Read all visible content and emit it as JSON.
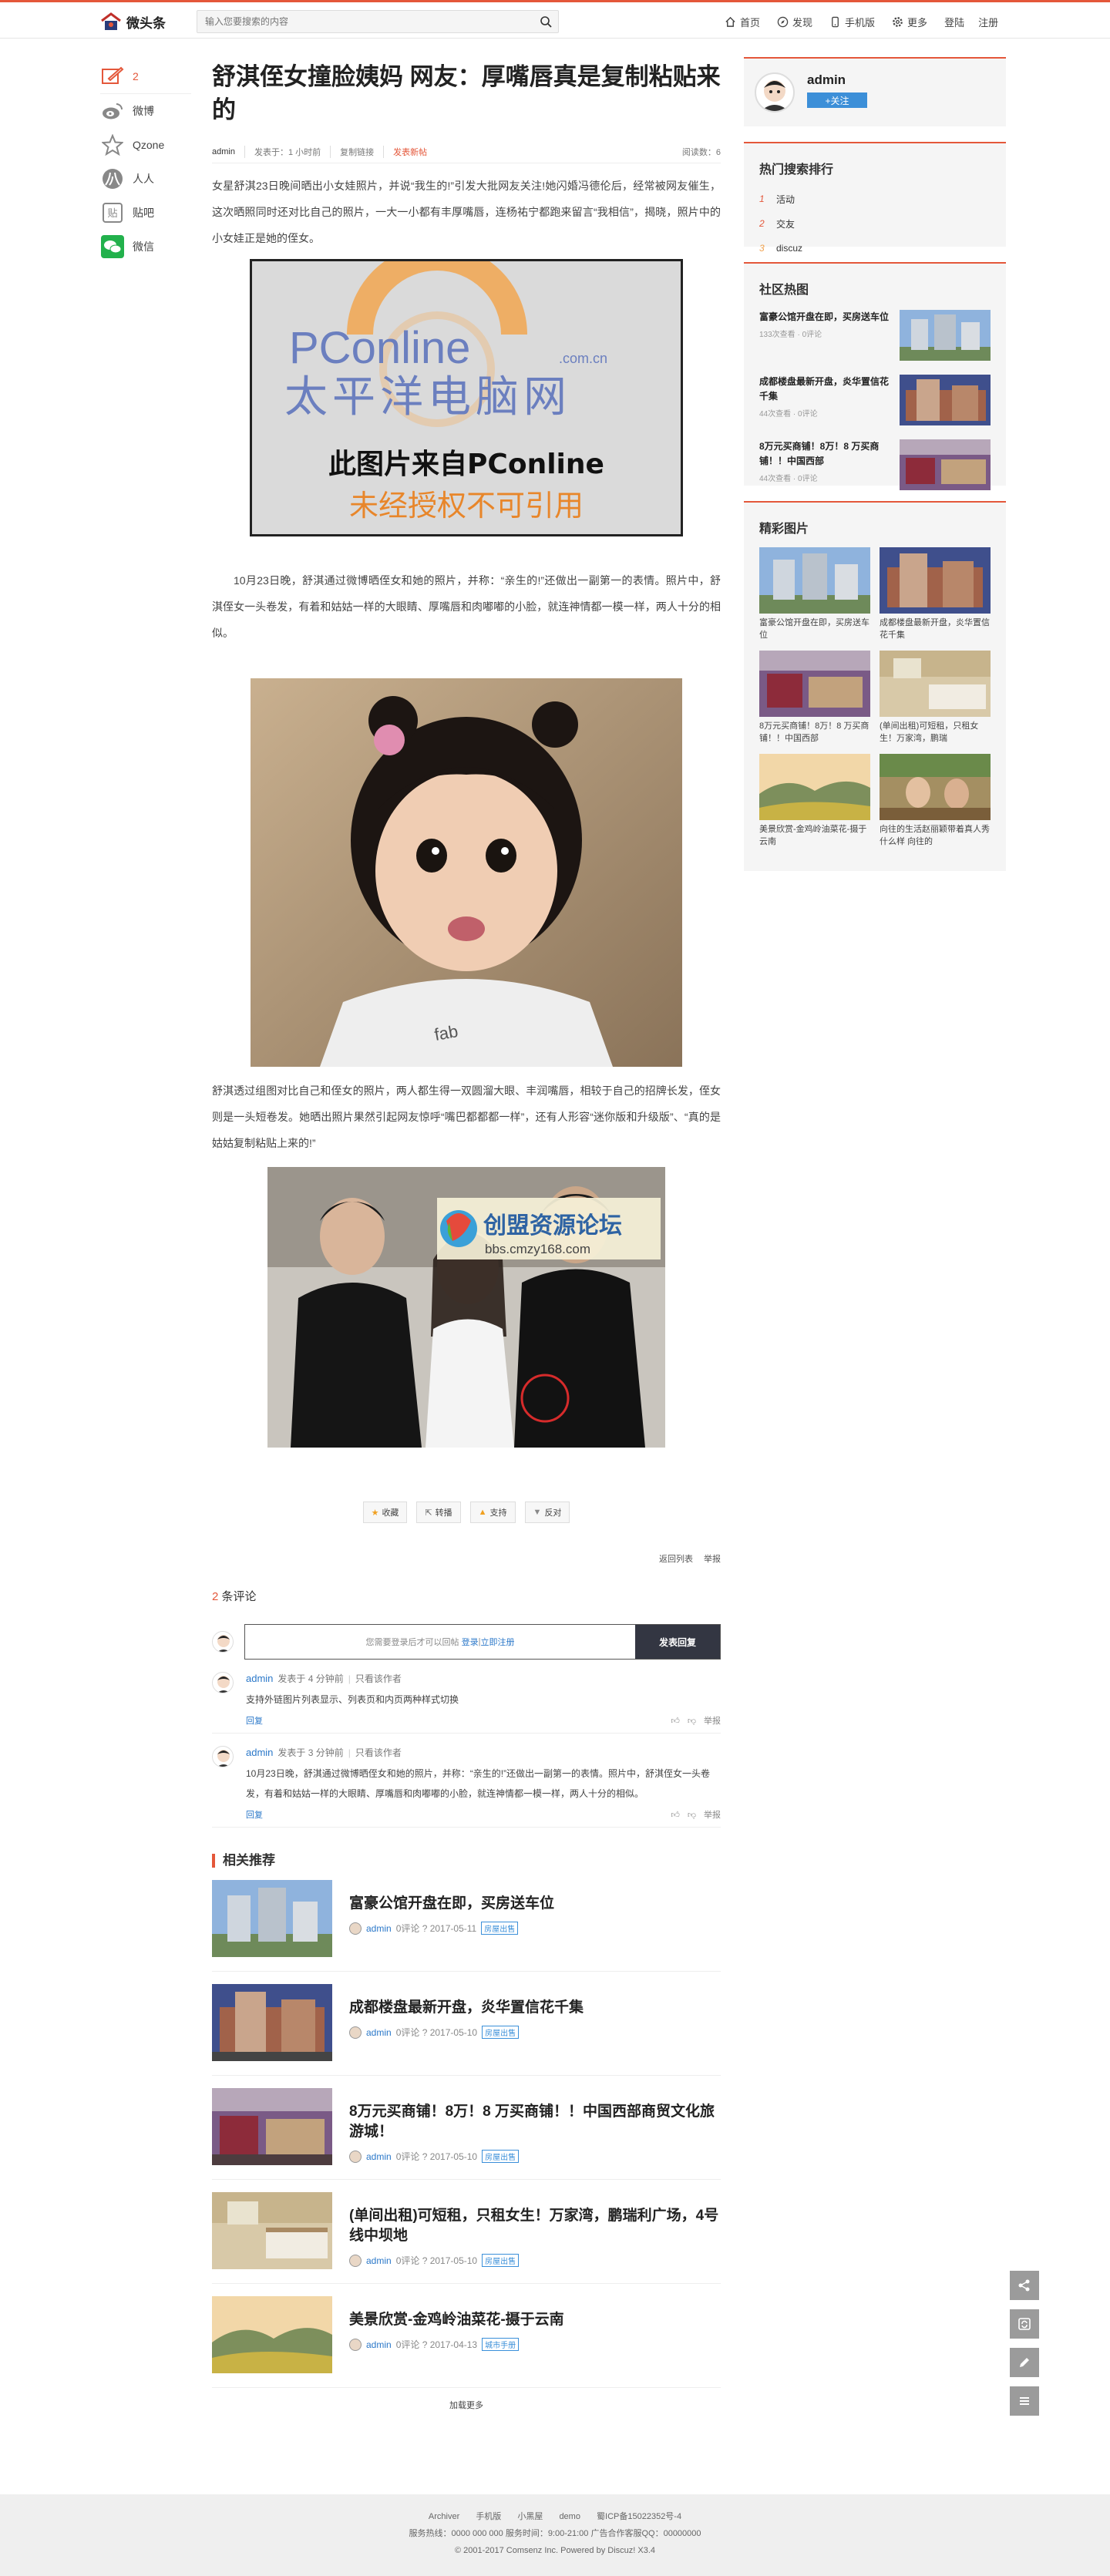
{
  "header": {
    "logo_text": "微头条",
    "search_placeholder": "输入您要搜索的内容",
    "nav": [
      {
        "label": "首页",
        "icon": "home-icon"
      },
      {
        "label": "发现",
        "icon": "compass-icon"
      },
      {
        "label": "手机版",
        "icon": "mobile-icon"
      },
      {
        "label": "更多",
        "icon": "gear-icon"
      }
    ],
    "login": "登陆",
    "register": "注册"
  },
  "share": {
    "comment_count": "2",
    "items": [
      {
        "label": "微博",
        "icon": "weibo-icon"
      },
      {
        "label": "Qzone",
        "icon": "qzone-icon"
      },
      {
        "label": "人人",
        "icon": "renren-icon"
      },
      {
        "label": "贴吧",
        "icon": "tieba-icon"
      },
      {
        "label": "微信",
        "icon": "wechat-icon"
      }
    ]
  },
  "article": {
    "title": "舒淇侄女撞脸姨妈 网友：厚嘴唇真是复制粘贴来的",
    "author": "admin",
    "posted": "发表于：1 小时前",
    "copy_link": "复制链接",
    "original": "发表新帖",
    "views": "阅读数：6",
    "p1": "女星舒淇23日晚间晒出小女娃照片，并说“我生的!”引发大批网友关注!她闪婚冯德伦后，经常被网友催生，这次晒照同时还对比自己的照片，一大一小都有丰厚嘴唇，连杨祐宁都跑来留言“我相信”，揭晓，照片中的小女娃正是她的侄女。",
    "img1": {
      "brand": "PConline",
      "domain": ".com.cn",
      "cn": "太平洋电脑网",
      "line1": "此图片来自PConline",
      "line2": "未经授权不可引用"
    },
    "p2": "10月23日晚，舒淇通过微博晒侄女和她的照片，并称：“亲生的!”还做出一副第一的表情。照片中，舒淇侄女一头卷发，有着和姑姑一样的大眼睛、厚嘴唇和肉嘟嘟的小脸，就连神情都一模一样，两人十分的相似。",
    "p3": "舒淇透过组图对比自己和侄女的照片，两人都生得一双圆溜大眼、丰润嘴唇，相较于自己的招牌长发，侄女则是一头短卷发。她晒出照片果然引起网友惊呼“嘴巴都都都一样”，还有人形容“迷你版和升级版”、“真的是姑姑复制粘贴上来的!”",
    "img3": {
      "forum_name": "创盟资源论坛",
      "forum_url": "bbs.cmzy168.com"
    },
    "actions": [
      {
        "label": "收藏",
        "icon": "star-icon"
      },
      {
        "label": "转播",
        "icon": "forward-icon"
      },
      {
        "label": "支持",
        "icon": "thumbs-up-icon"
      },
      {
        "label": "反对",
        "icon": "thumbs-down-icon"
      }
    ],
    "back": "返回列表",
    "report": "举报"
  },
  "comments": {
    "count": "2",
    "label": "条评论",
    "login_hint_pre": "您需要登录后才可以回帖",
    "login": "登录",
    "sep": " | ",
    "register": "立即注册",
    "post_btn": "发表回复",
    "items": [
      {
        "user": "admin",
        "time": "发表于 4 分钟前",
        "only": "只看该作者",
        "text": "支持外链图片列表显示、列表页和内页两种样式切换",
        "reply": "回复",
        "report": "举报"
      },
      {
        "user": "admin",
        "time": "发表于 3 分钟前",
        "only": "只看该作者",
        "text": "10月23日晚，舒淇通过微博晒侄女和她的照片，并称：“亲生的!”还做出一副第一的表情。照片中，舒淇侄女一头卷发，有着和姑姑一样的大眼睛、厚嘴唇和肉嘟嘟的小脸，就连神情都一模一样，两人十分的相似。",
        "reply": "回复",
        "report": "举报"
      }
    ]
  },
  "related": {
    "title": "相关推荐",
    "items": [
      {
        "title": "富豪公馆开盘在即，买房送车位",
        "user": "admin",
        "meta": "0评论 ? 2017-05-11",
        "tag": "房屋出售"
      },
      {
        "title": "成都楼盘最新开盘，炎华置信花千集",
        "user": "admin",
        "meta": "0评论 ? 2017-05-10",
        "tag": "房屋出售"
      },
      {
        "title": "8万元买商铺！8万！8 万买商铺！！中国西部商贸文化旅游城！",
        "user": "admin",
        "meta": "0评论 ? 2017-05-10",
        "tag": "房屋出售"
      },
      {
        "title": "(单间出租)可短租，只租女生！万家湾，鹏瑞利广场，4号线中坝地",
        "user": "admin",
        "meta": "0评论 ? 2017-05-10",
        "tag": "房屋出售"
      },
      {
        "title": "美景欣赏-金鸡岭油菜花-摄于云南",
        "user": "admin",
        "meta": "0评论 ? 2017-04-13",
        "tag": "城市手册"
      }
    ],
    "load_more": "加载更多"
  },
  "sidebar": {
    "user": "admin",
    "follow": "+关注",
    "hot_title": "热门搜索排行",
    "hot": [
      {
        "rank": "1",
        "word": "活动"
      },
      {
        "rank": "2",
        "word": "交友"
      },
      {
        "rank": "3",
        "word": "discuz"
      }
    ],
    "community_title": "社区热图",
    "community": [
      {
        "title": "富豪公馆开盘在即，买房送车位",
        "stats": "133次查看 · 0评论"
      },
      {
        "title": "成都楼盘最新开盘，炎华置信花千集",
        "stats": "44次查看 · 0评论"
      },
      {
        "title": "8万元买商铺！8万！8 万买商铺！！中国西部",
        "stats": "44次查看 · 0评论"
      }
    ],
    "pics_title": "精彩图片",
    "pics": [
      {
        "title": "富豪公馆开盘在即，买房送车位"
      },
      {
        "title": "成都楼盘最新开盘，炎华置信花千集"
      },
      {
        "title": "8万元买商铺！8万！8 万买商铺！！中国西部"
      },
      {
        "title": "(单间出租)可短租，只租女生！万家湾，鹏瑞"
      },
      {
        "title": "美景欣赏-金鸡岭油菜花-摄于云南"
      },
      {
        "title": "向往的生活赵丽颖带着真人秀什么样 向往的"
      }
    ]
  },
  "footer": {
    "links": [
      "Archiver",
      "手机版",
      "小黑屋",
      "demo",
      "蜀ICP备15022352号-4"
    ],
    "service": "服务热线：0000 000 000   服务时间：9:00-21:00   广告合作客服QQ：00000000",
    "copyright": "© 2001-2017 Comsenz Inc.    Powered by Discuz! X3.4"
  },
  "colors": {
    "accent": "#e4573a",
    "link": "#2b78c9",
    "follow": "#3c8fd8"
  }
}
